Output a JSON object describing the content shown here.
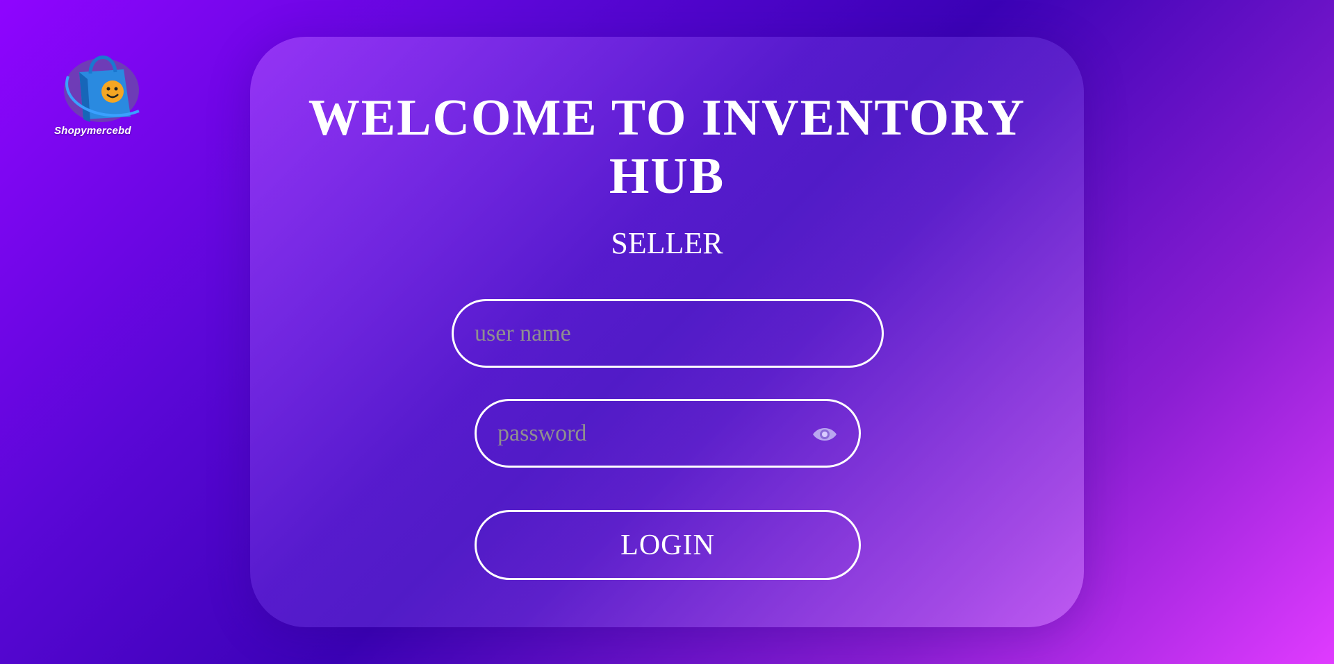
{
  "brand": {
    "logo_icon": "shopping-bag-logo",
    "name": "Shopymercebd"
  },
  "login_card": {
    "title": "WELCOME TO INVENTORY HUB",
    "subtitle": "SELLER",
    "username": {
      "placeholder": "user name",
      "value": ""
    },
    "password": {
      "placeholder": "password",
      "value": "",
      "toggle_icon": "eye-icon"
    },
    "login_label": "LOGIN"
  },
  "colors": {
    "background_start": "#8f05ff",
    "background_mid": "#3b02b6",
    "background_end": "#e03bff",
    "text": "#ffffff",
    "placeholder": "#8f8f8f",
    "eye_icon": "#b9a6f0"
  }
}
